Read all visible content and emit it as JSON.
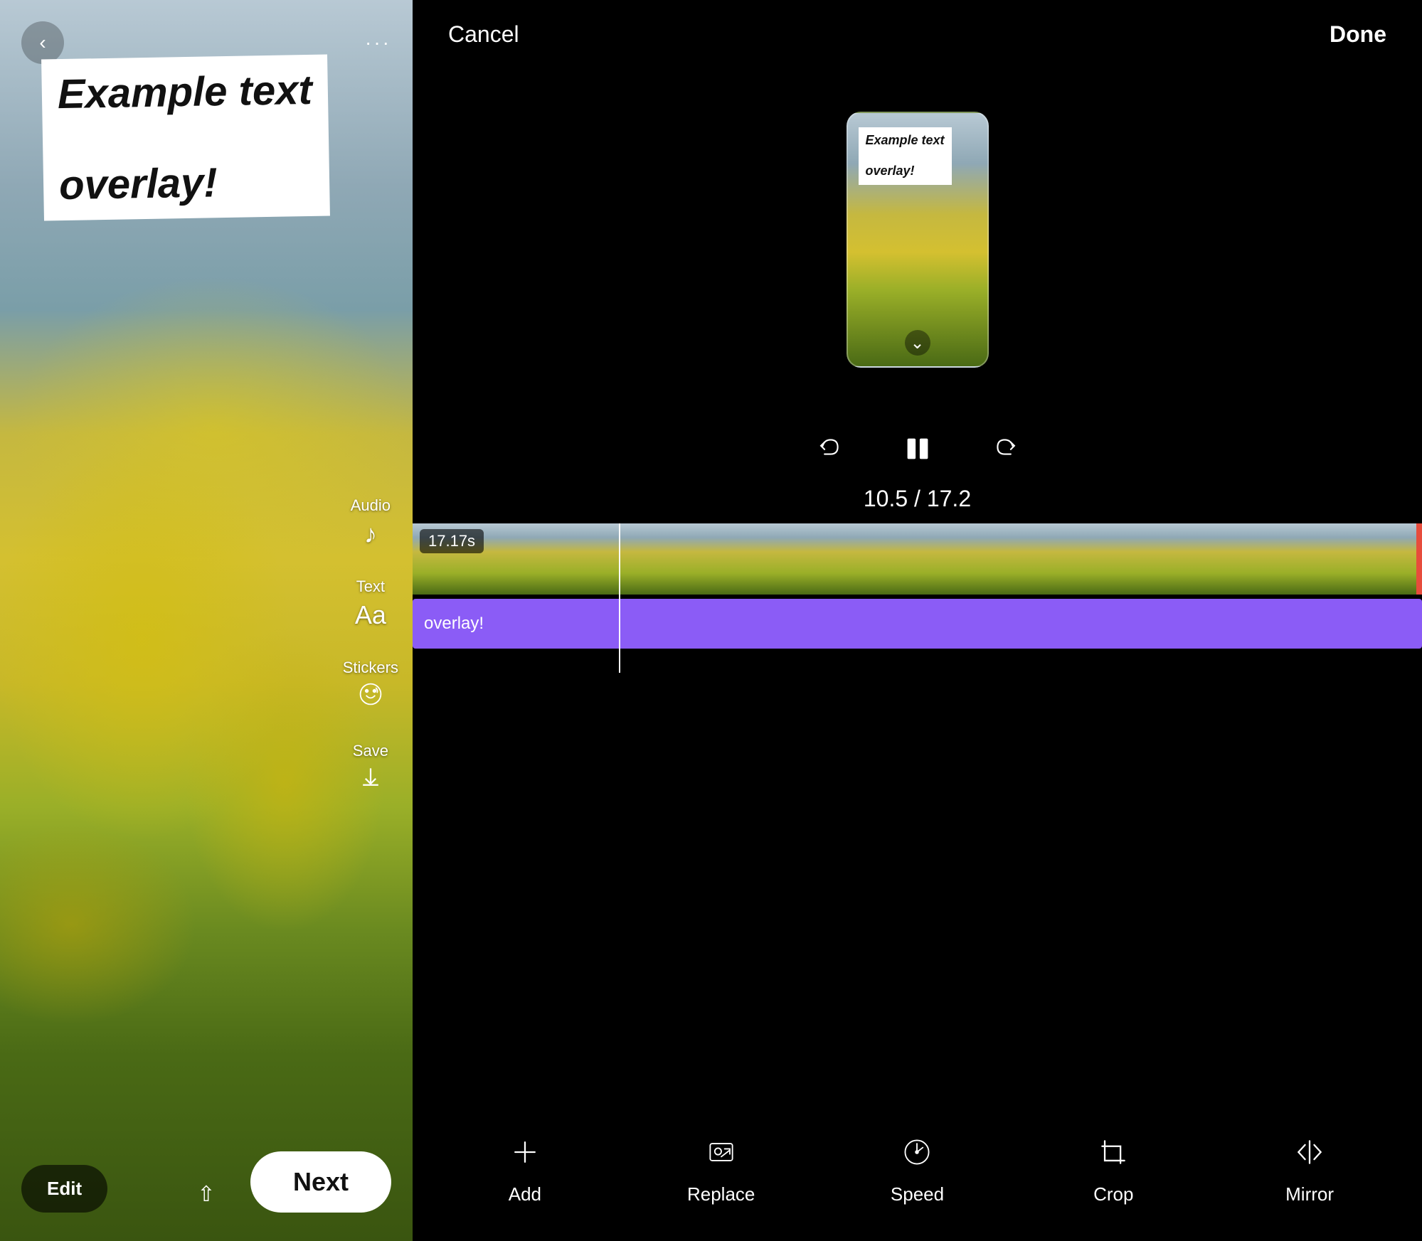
{
  "left": {
    "text_overlay_line1": "Example text",
    "text_overlay_line2": "overlay!",
    "tools": [
      {
        "label": "Audio",
        "icon": "♪"
      },
      {
        "label": "Text",
        "icon": "Aa"
      },
      {
        "label": "Stickers",
        "icon": "😊"
      },
      {
        "label": "Save",
        "icon": "↓"
      }
    ],
    "edit_label": "Edit",
    "next_label": "Next"
  },
  "right": {
    "cancel_label": "Cancel",
    "done_label": "Done",
    "preview_text_line1": "Example text",
    "preview_text_line2": "overlay!",
    "time_current": "10.5",
    "time_total": "17.2",
    "time_display": "10.5 / 17.2",
    "video_duration_badge": "17.17s",
    "text_track_label": "overlay!",
    "toolbar": [
      {
        "label": "Add",
        "icon": "add"
      },
      {
        "label": "Replace",
        "icon": "replace"
      },
      {
        "label": "Speed",
        "icon": "speed"
      },
      {
        "label": "Crop",
        "icon": "crop"
      },
      {
        "label": "Mirror",
        "icon": "mirror"
      }
    ]
  }
}
